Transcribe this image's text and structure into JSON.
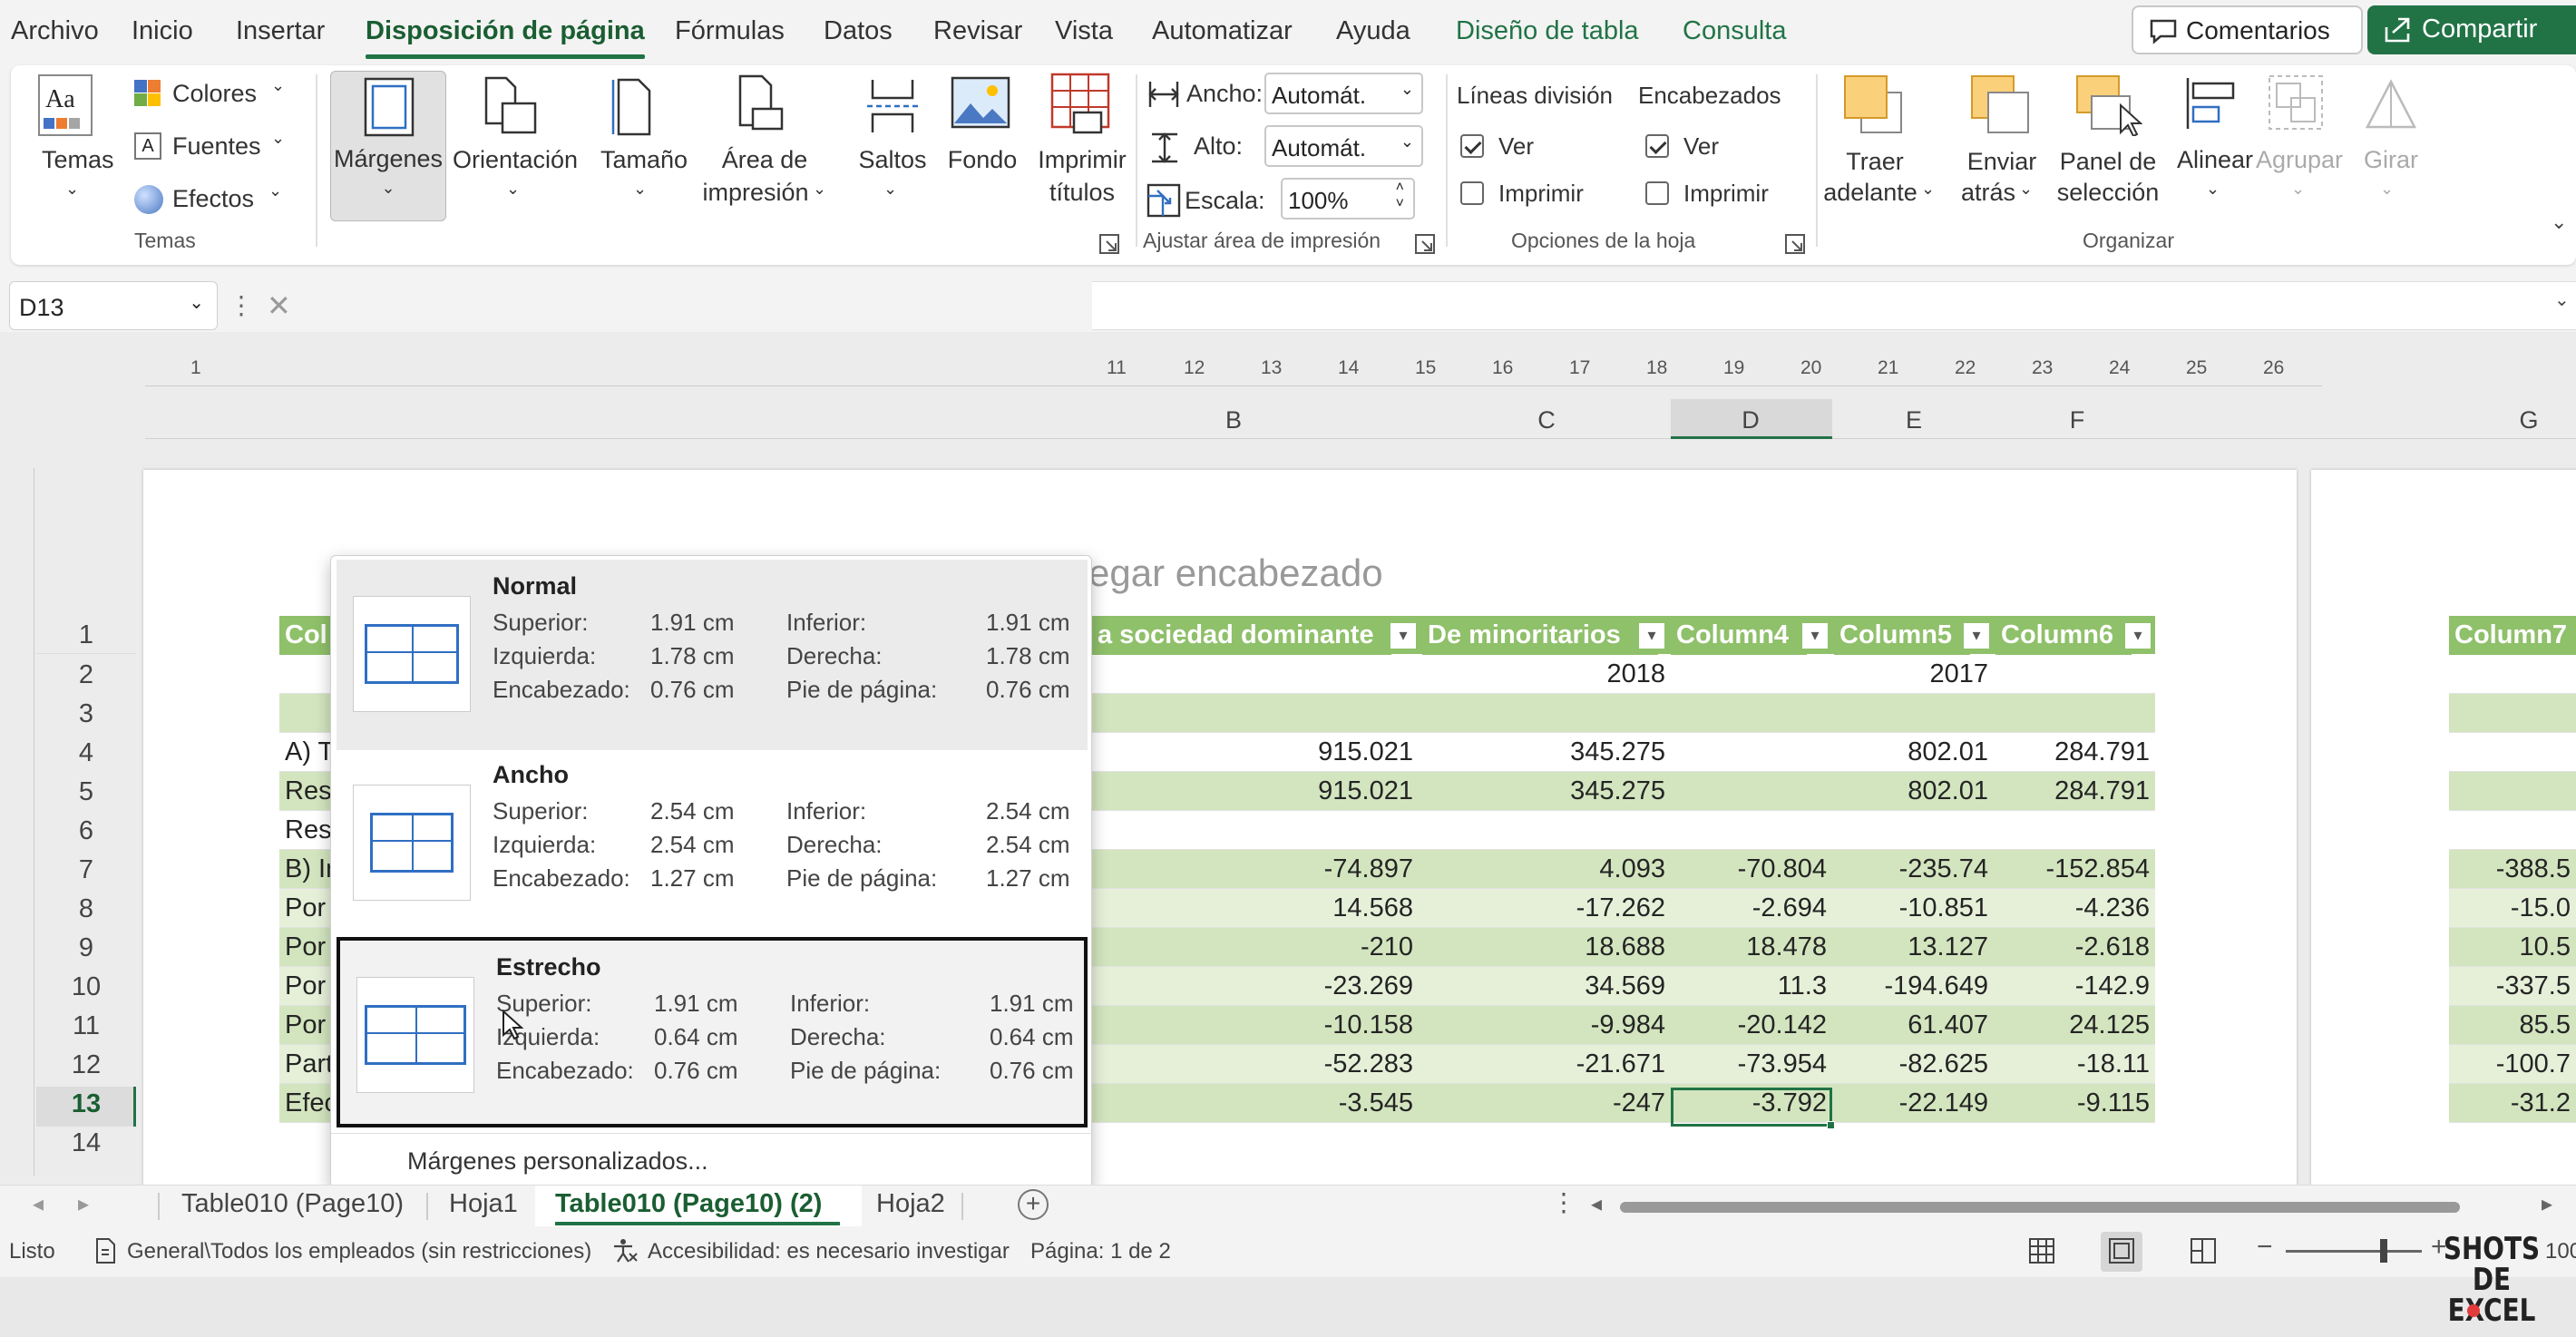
{
  "menu": {
    "items": [
      "Archivo",
      "Inicio",
      "Insertar",
      "Disposición de página",
      "Fórmulas",
      "Datos",
      "Revisar",
      "Vista",
      "Automatizar",
      "Ayuda",
      "Diseño de tabla",
      "Consulta"
    ],
    "active_index": 3,
    "comments_label": "Comentarios",
    "share_label": "Compartir"
  },
  "ribbon": {
    "temas": {
      "temas_label": "Temas",
      "colores": "Colores",
      "fuentes": "Fuentes",
      "efectos": "Efectos",
      "group": "Temas"
    },
    "setup": {
      "margenes": "Márgenes",
      "orientacion": "Orientación",
      "tamano": "Tamaño",
      "area1": "Área de",
      "area2": "impresión",
      "saltos": "Saltos",
      "fondo": "Fondo",
      "imprimir1": "Imprimir",
      "imprimir2": "títulos"
    },
    "ajustar": {
      "ancho_label": "Ancho:",
      "ancho_value": "Automát.",
      "alto_label": "Alto:",
      "alto_value": "Automát.",
      "escala_label": "Escala:",
      "escala_value": "100%",
      "group": "Ajustar área de impresión"
    },
    "opciones": {
      "lineas": "Líneas división",
      "encabezados": "Encabezados",
      "ver": "Ver",
      "imprimir": "Imprimir",
      "group": "Opciones de la hoja"
    },
    "organizar": {
      "traer1": "Traer",
      "traer2": "adelante",
      "enviar1": "Enviar",
      "enviar2": "atrás",
      "panel1": "Panel de",
      "panel2": "selección",
      "alinear": "Alinear",
      "agrupar": "Agrupar",
      "girar": "Girar",
      "group": "Organizar"
    }
  },
  "namebox": "D13",
  "ruler": [
    "1",
    "11",
    "12",
    "13",
    "14",
    "15",
    "16",
    "17",
    "18",
    "19",
    "20",
    "21",
    "22",
    "23",
    "24",
    "25",
    "26"
  ],
  "columns": [
    "B",
    "C",
    "D",
    "E",
    "F",
    "G"
  ],
  "header_placeholder": "egar encabezado",
  "table_headers": [
    "Col",
    "a sociedad dominante",
    "De minoritarios",
    "Column4",
    "Column5",
    "Column6",
    "Column7"
  ],
  "row_numbers": [
    "1",
    "2",
    "3",
    "4",
    "5",
    "6",
    "7",
    "8",
    "9",
    "10",
    "11",
    "12",
    "13",
    "14"
  ],
  "rows": [
    {
      "a": "",
      "b": "",
      "c": "2018",
      "d": "",
      "e": "2017",
      "f": "",
      "g": ""
    },
    {
      "a": "",
      "b": "",
      "c": "",
      "d": "",
      "e": "",
      "f": "",
      "g": ""
    },
    {
      "a": "A) T",
      "b": "915.021",
      "c": "345.275",
      "d": "",
      "e": "802.01",
      "f": "284.791",
      "g": ""
    },
    {
      "a": "Res",
      "b": "915.021",
      "c": "345.275",
      "d": "",
      "e": "802.01",
      "f": "284.791",
      "g": ""
    },
    {
      "a": "Resultado de actividades interrumpidas",
      "b": "",
      "c": "",
      "d": "",
      "e": "",
      "f": "",
      "g": ""
    },
    {
      "a": "B) Ingresos y gastos imputados directamente enpatrimonio",
      "b": "-74.897",
      "c": "4.093",
      "d": "-70.804",
      "e": "-235.74",
      "f": "-152.854",
      "g": "-388.5"
    },
    {
      "a": "Por valoración de instrumentos financieros",
      "b": "14.568",
      "c": "-17.262",
      "d": "-2.694",
      "e": "-10.851",
      "f": "-4.236",
      "g": "-15.0"
    },
    {
      "a": "Por coberturas de flujos de efectivo",
      "b": "-210",
      "c": "18.688",
      "d": "18.478",
      "e": "13.127",
      "f": "-2.618",
      "g": "10.5"
    },
    {
      "a": "Por diferencias de conversión",
      "b": "-23.269",
      "c": "34.569",
      "d": "11.3",
      "e": "-194.649",
      "f": "-142.9",
      "g": "-337.5"
    },
    {
      "a": "Por ganancias y pérdidas actuariales ( * )",
      "b": "-10.158",
      "c": "-9.984",
      "d": "-20.142",
      "e": "61.407",
      "f": "24.125",
      "g": "85.5"
    },
    {
      "a": "Participaciones puestas en equivalencia",
      "b": "-52.283",
      "c": "-21.671",
      "d": "-73.954",
      "e": "-82.625",
      "f": "-18.11",
      "g": "-100.7"
    },
    {
      "a": "Efecto impositivo",
      "b": "-3.545",
      "c": "-247",
      "d": "-3.792",
      "e": "-22.149",
      "f": "-9.115",
      "g": "-31.2"
    }
  ],
  "margins_dropdown": {
    "options": [
      {
        "name": "Normal",
        "sup_l": "Superior:",
        "sup": "1.91 cm",
        "inf_l": "Inferior:",
        "inf": "1.91 cm",
        "izq_l": "Izquierda:",
        "izq": "1.78 cm",
        "der_l": "Derecha:",
        "der": "1.78 cm",
        "enc_l": "Encabezado:",
        "enc": "0.76 cm",
        "pie_l": "Pie de página:",
        "pie": "0.76 cm"
      },
      {
        "name": "Ancho",
        "sup_l": "Superior:",
        "sup": "2.54 cm",
        "inf_l": "Inferior:",
        "inf": "2.54 cm",
        "izq_l": "Izquierda:",
        "izq": "2.54 cm",
        "der_l": "Derecha:",
        "der": "2.54 cm",
        "enc_l": "Encabezado:",
        "enc": "1.27 cm",
        "pie_l": "Pie de página:",
        "pie": "1.27 cm"
      },
      {
        "name": "Estrecho",
        "sup_l": "Superior:",
        "sup": "1.91 cm",
        "inf_l": "Inferior:",
        "inf": "1.91 cm",
        "izq_l": "Izquierda:",
        "izq": "0.64 cm",
        "der_l": "Derecha:",
        "der": "0.64 cm",
        "enc_l": "Encabezado:",
        "enc": "0.76 cm",
        "pie_l": "Pie de página:",
        "pie": "0.76 cm"
      }
    ],
    "custom": "Márgenes personalizados..."
  },
  "tabs": [
    "Table010 (Page10)",
    "Hoja1",
    "Table010 (Page10) (2)",
    "Hoja2"
  ],
  "active_tab": 2,
  "status": {
    "ready": "Listo",
    "sensitivity": "General\\Todos los empleados (sin restricciones)",
    "accessibility": "Accesibilidad: es necesario investigar",
    "page": "Página: 1 de 2",
    "zoom": "100"
  },
  "watermark": {
    "line1": "SHOTS",
    "line2": "DE EXCEL"
  },
  "colors": {
    "accent": "#217346",
    "table_header": "#8fc06a",
    "band": "#e6f0d9",
    "band_dark": "#d3e5bf"
  }
}
